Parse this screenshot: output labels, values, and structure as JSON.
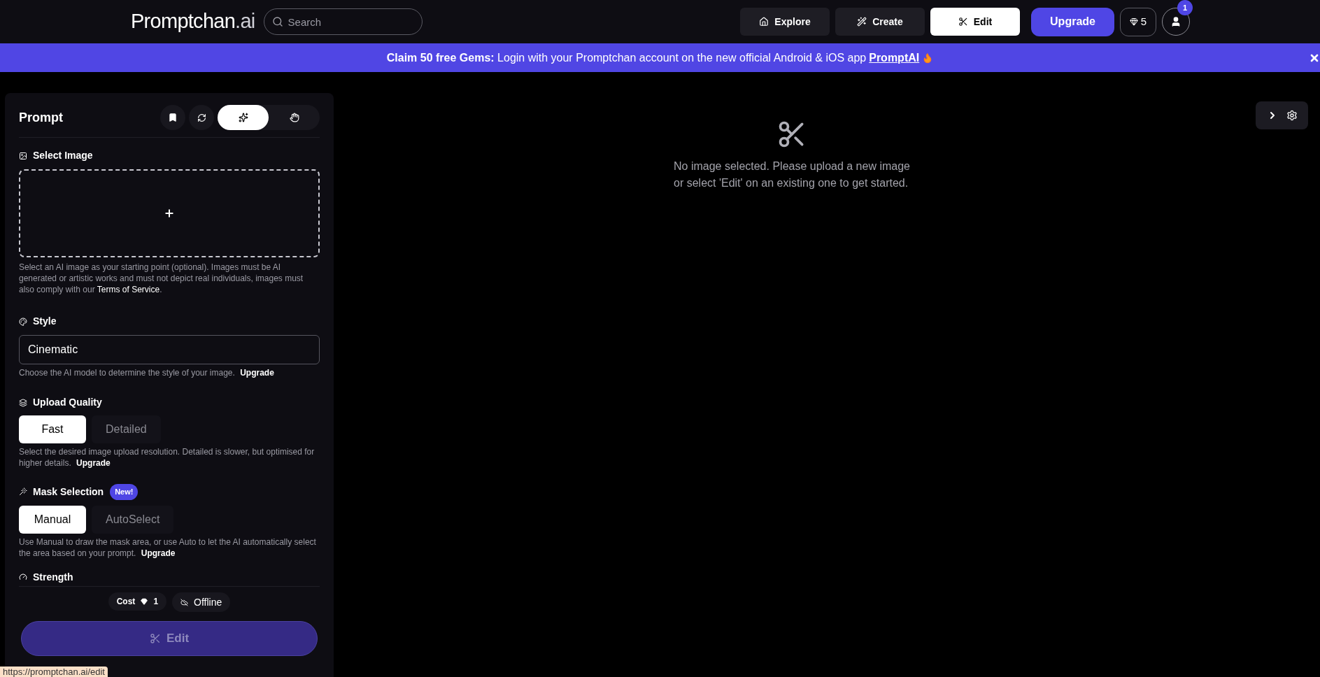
{
  "header": {
    "logo": {
      "main": "Promptchan",
      "suffix": ".ai"
    },
    "search": {
      "placeholder": "Search"
    },
    "nav": [
      {
        "label": "Explore",
        "selected": false
      },
      {
        "label": "Create",
        "selected": false
      },
      {
        "label": "Edit",
        "selected": true
      }
    ],
    "upgrade": "Upgrade",
    "gems": "5",
    "notifications": "1"
  },
  "banner": {
    "lead": "Claim 50 free Gems:",
    "text": "Login with your Promptchan account on the new official Android & iOS app",
    "link": "PromptAI"
  },
  "panel": {
    "title": "Prompt",
    "mode_toggle": [
      {
        "selected": true
      },
      {
        "selected": false
      }
    ],
    "select_image": {
      "label": "Select Image",
      "help": "Select an AI image as your starting point (optional). Images must be AI generated or artistic works and must not depict real individuals, images must also comply with our ",
      "link": "Terms of Service",
      "help_end": "."
    },
    "style": {
      "label": "Style",
      "value": "Cinematic",
      "help": "Choose the AI model to determine the style of your image.",
      "link": "Upgrade"
    },
    "upload_quality": {
      "label": "Upload Quality",
      "options": [
        {
          "label": "Fast",
          "selected": true
        },
        {
          "label": "Detailed",
          "selected": false
        }
      ],
      "help": "Select the desired image upload resolution. Detailed is slower, but optimised for higher details.",
      "link": "Upgrade"
    },
    "mask_selection": {
      "label": "Mask Selection",
      "badge": "New!",
      "options": [
        {
          "label": "Manual",
          "selected": true
        },
        {
          "label": "AutoSelect",
          "selected": false
        }
      ],
      "help": "Use Manual to draw the mask area, or use Auto to let the AI automatically select the area based on your prompt.",
      "link": "Upgrade"
    },
    "strength": {
      "label": "Strength"
    },
    "footer": {
      "cost_label": "Cost",
      "cost": "1",
      "status": "Offline",
      "action": "Edit"
    }
  },
  "main": {
    "message": [
      "No image selected. Please upload a new image",
      "or select 'Edit' on an existing one to get started."
    ]
  },
  "status_url": "https://promptchan.ai/edit"
}
